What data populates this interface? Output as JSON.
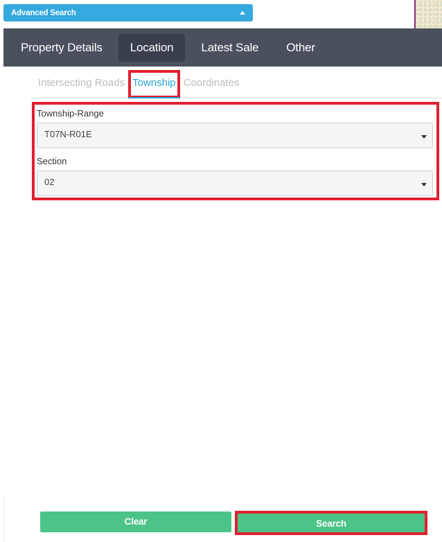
{
  "advanced_search": {
    "label": "Advanced Search",
    "toggle_icon": "caret-up-icon"
  },
  "main_tabs": [
    {
      "label": "Property Details",
      "active": false
    },
    {
      "label": "Location",
      "active": true
    },
    {
      "label": "Latest Sale",
      "active": false
    },
    {
      "label": "Other",
      "active": false
    }
  ],
  "sub_tabs": [
    {
      "label": "Intersecting Roads",
      "active": false
    },
    {
      "label": "Township",
      "active": true
    },
    {
      "label": "Coordinates",
      "active": false
    }
  ],
  "form": {
    "township_range": {
      "label": "Township-Range",
      "value": "T07N-R01E",
      "icon": "caret-down-icon"
    },
    "section": {
      "label": "Section",
      "value": "02",
      "icon": "caret-down-icon"
    }
  },
  "actions": {
    "clear_label": "Clear",
    "search_label": "Search"
  },
  "colors": {
    "accent_blue": "#35a8e0",
    "tab_bar": "#4b505d",
    "active_tab": "#3a3f4c",
    "active_subtab": "#2aa3d6",
    "button_green": "#4cc387",
    "highlight_red": "#e02030"
  }
}
